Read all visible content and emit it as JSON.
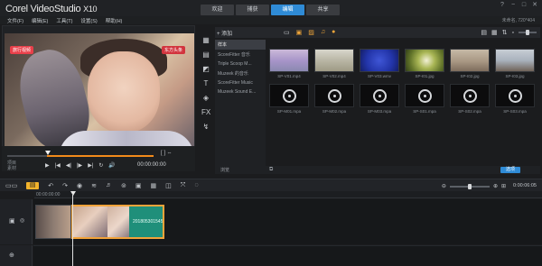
{
  "app": {
    "brand_main": "Corel VideoStudio",
    "brand_version": "X10"
  },
  "mode_tabs": [
    "欢迎",
    "捕获",
    "编辑",
    "共享"
  ],
  "active_mode_index": 2,
  "window_controls": [
    "?",
    "−",
    "□",
    "✕"
  ],
  "menu": [
    "文件(F)",
    "编辑(E)",
    "工具(T)",
    "设置(S)",
    "帮助(H)"
  ],
  "status_text": "未命名, 720*404",
  "player": {
    "watermark_left": "旅行视频",
    "watermark_right": "东方头条",
    "project_label": "项目",
    "clip_label": "素材",
    "timecode": "00:00:00:00",
    "transport_buttons": [
      "▶",
      "|◀",
      "◀|",
      "|▶",
      "▶|",
      "↻",
      "🔊"
    ],
    "brackets": "[ ] ⇔"
  },
  "library": {
    "add_label": "+ 添加",
    "folders": [
      "样本",
      "ScoreFitter 音乐",
      "Triple Scoop M...",
      "Muzeek 的音乐",
      "ScoreFitter Music",
      "Muzeek Sound E..."
    ],
    "selected_folder_index": 0,
    "thumbnails": [
      {
        "caption": "SP-V01.mp4",
        "kind": "t1"
      },
      {
        "caption": "SP-V02.mp4",
        "kind": "t2"
      },
      {
        "caption": "SP-V03.wmv",
        "kind": "t3"
      },
      {
        "caption": "SP-I01.jpg",
        "kind": "t4"
      },
      {
        "caption": "SP-I02.jpg",
        "kind": "t5"
      },
      {
        "caption": "SP-I03.jpg",
        "kind": "t6"
      },
      {
        "caption": "SP-M01.mpa",
        "kind": "disc"
      },
      {
        "caption": "SP-M02.mpa",
        "kind": "disc"
      },
      {
        "caption": "SP-M03.mpa",
        "kind": "disc"
      },
      {
        "caption": "SP-S01.mpa",
        "kind": "disc"
      },
      {
        "caption": "SP-S02.mpa",
        "kind": "disc"
      },
      {
        "caption": "SP-S03.mpa",
        "kind": "disc"
      }
    ],
    "browse_label": "浏览",
    "advanced_button": "选项"
  },
  "timeline": {
    "duration": "0:00:06:05",
    "ruler_start": "00:00:00:00",
    "clip2_name": "20180530154507"
  }
}
